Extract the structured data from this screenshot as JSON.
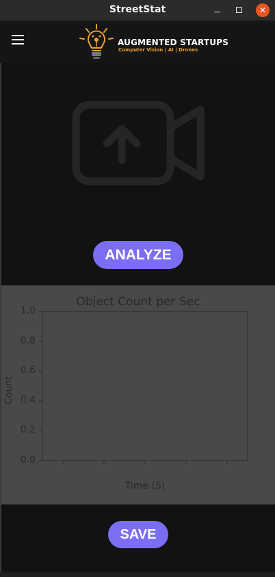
{
  "window": {
    "title": "StreetStat",
    "close_glyph": "✕"
  },
  "header": {
    "brand_name": "AUGMENTED STARTUPS",
    "brand_tagline": "Computer Vision | AI | Drones",
    "menu_icon": "hamburger-menu-icon",
    "logo_icon": "lightbulb-logo-icon",
    "accent_color": "#f0a030"
  },
  "main": {
    "upload_icon": "video-upload-icon",
    "analyze_label": "ANALYZE",
    "save_label": "SAVE",
    "button_color": "#7c6ef2"
  },
  "chart_data": {
    "type": "line",
    "title": "Object Count per Sec",
    "xlabel": "Time (S)",
    "ylabel": "Count",
    "ylim": [
      0.0,
      1.0
    ],
    "yticks": [
      "0.0",
      "0.2",
      "0.4",
      "0.6",
      "0.8",
      "1.0"
    ],
    "xticks": [
      "",
      "",
      "",
      "",
      ""
    ],
    "series": [],
    "grid": false
  }
}
